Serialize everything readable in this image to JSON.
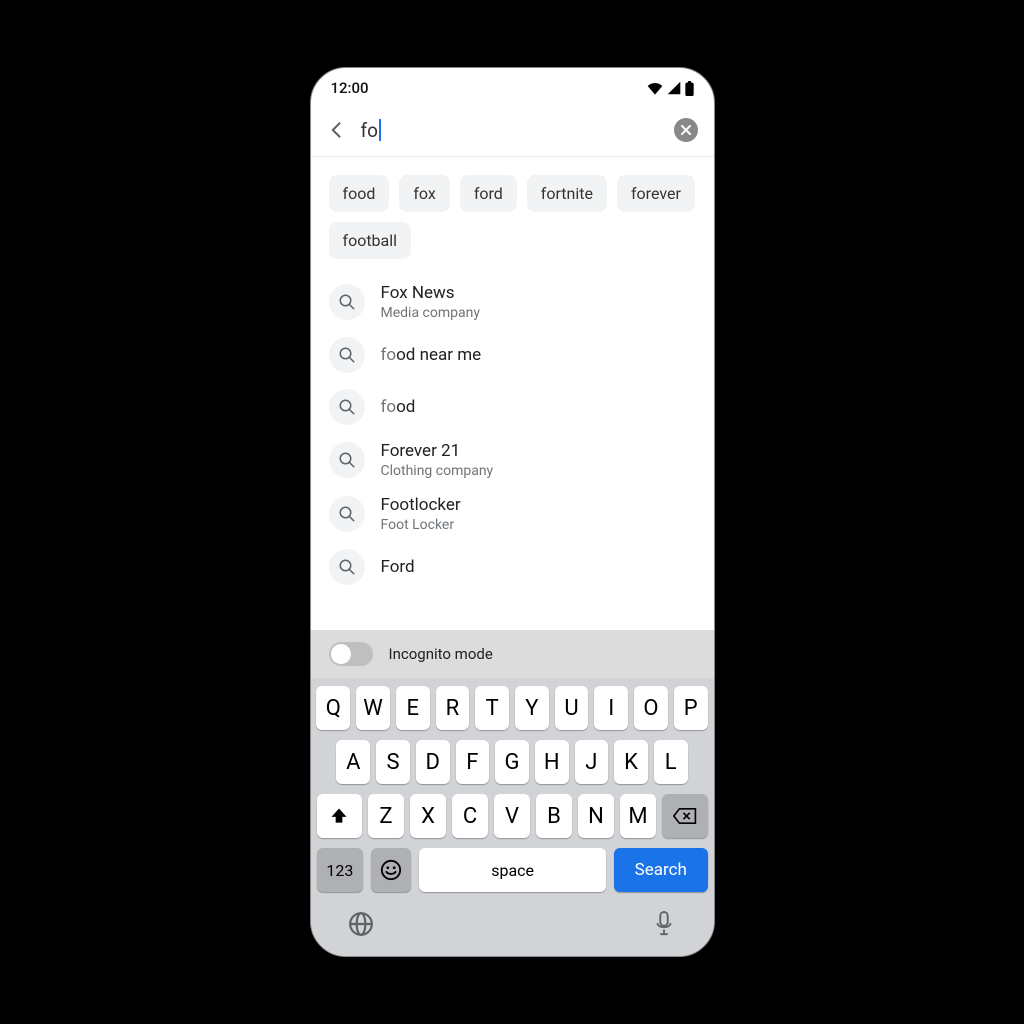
{
  "status": {
    "time": "12:00"
  },
  "search": {
    "query": "fo"
  },
  "chips": [
    "food",
    "fox",
    "ford",
    "fortnite",
    "forever",
    "football"
  ],
  "suggestions": [
    {
      "title": "Fox News",
      "subtitle": "Media company",
      "prefix": ""
    },
    {
      "title": "od near me",
      "subtitle": "",
      "prefix": "fo"
    },
    {
      "title": "od",
      "subtitle": "",
      "prefix": "fo"
    },
    {
      "title": "Forever 21",
      "subtitle": "Clothing company",
      "prefix": ""
    },
    {
      "title": "Footlocker",
      "subtitle": "Foot Locker",
      "prefix": ""
    },
    {
      "title": "Ford",
      "subtitle": "",
      "prefix": ""
    }
  ],
  "incognito": {
    "label": "Incognito mode",
    "on": false
  },
  "keyboard": {
    "row1": [
      "Q",
      "W",
      "E",
      "R",
      "T",
      "Y",
      "U",
      "I",
      "O",
      "P"
    ],
    "row2": [
      "A",
      "S",
      "D",
      "F",
      "G",
      "H",
      "J",
      "K",
      "L"
    ],
    "row3": [
      "Z",
      "X",
      "C",
      "V",
      "B",
      "N",
      "M"
    ],
    "numbers_label": "123",
    "space_label": "space",
    "search_label": "Search"
  }
}
